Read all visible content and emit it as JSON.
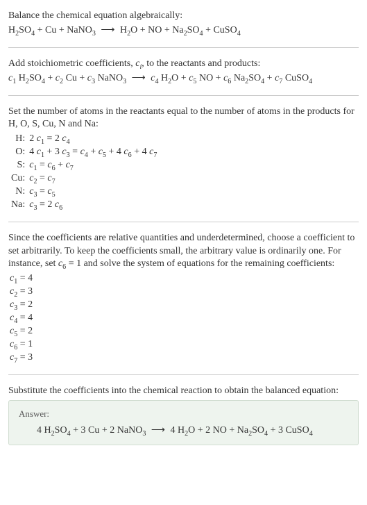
{
  "s1": {
    "intro": "Balance the chemical equation algebraically:",
    "eqn": "H<sub>2</sub>SO<sub>4</sub> + Cu + NaNO<sub>3</sub> <span class=\"arrow\">⟶</span> H<sub>2</sub>O + NO + Na<sub>2</sub>SO<sub>4</sub> + CuSO<sub>4</sub>"
  },
  "s2": {
    "intro": "Add stoichiometric coefficients, <span class=\"ci\">c<sub>i</sub></span>, to the reactants and products:",
    "eqn": "<span class=\"ci\">c</span><sub>1</sub> H<sub>2</sub>SO<sub>4</sub> + <span class=\"ci\">c</span><sub>2</sub> Cu + <span class=\"ci\">c</span><sub>3</sub> NaNO<sub>3</sub> <span class=\"arrow\">⟶</span> <span class=\"ci\">c</span><sub>4</sub> H<sub>2</sub>O + <span class=\"ci\">c</span><sub>5</sub> NO + <span class=\"ci\">c</span><sub>6</sub> Na<sub>2</sub>SO<sub>4</sub> + <span class=\"ci\">c</span><sub>7</sub> CuSO<sub>4</sub>"
  },
  "s3": {
    "intro": "Set the number of atoms in the reactants equal to the number of atoms in the products for H, O, S, Cu, N and Na:",
    "rows": [
      {
        "sym": "H:",
        "eq": "2 <span class=\"ci\">c</span><sub>1</sub> = 2 <span class=\"ci\">c</span><sub>4</sub>"
      },
      {
        "sym": "O:",
        "eq": "4 <span class=\"ci\">c</span><sub>1</sub> + 3 <span class=\"ci\">c</span><sub>3</sub> = <span class=\"ci\">c</span><sub>4</sub> + <span class=\"ci\">c</span><sub>5</sub> + 4 <span class=\"ci\">c</span><sub>6</sub> + 4 <span class=\"ci\">c</span><sub>7</sub>"
      },
      {
        "sym": "S:",
        "eq": "<span class=\"ci\">c</span><sub>1</sub> = <span class=\"ci\">c</span><sub>6</sub> + <span class=\"ci\">c</span><sub>7</sub>"
      },
      {
        "sym": "Cu:",
        "eq": "<span class=\"ci\">c</span><sub>2</sub> = <span class=\"ci\">c</span><sub>7</sub>"
      },
      {
        "sym": "N:",
        "eq": "<span class=\"ci\">c</span><sub>3</sub> = <span class=\"ci\">c</span><sub>5</sub>"
      },
      {
        "sym": "Na:",
        "eq": "<span class=\"ci\">c</span><sub>3</sub> = 2 <span class=\"ci\">c</span><sub>6</sub>"
      }
    ]
  },
  "s4": {
    "intro": "Since the coefficients are relative quantities and underdetermined, choose a coefficient to set arbitrarily. To keep the coefficients small, the arbitrary value is ordinarily one. For instance, set <span class=\"ci\">c</span><sub>6</sub> = 1 and solve the system of equations for the remaining coefficients:",
    "coeffs": [
      "<span class=\"ci\">c</span><sub>1</sub> = 4",
      "<span class=\"ci\">c</span><sub>2</sub> = 3",
      "<span class=\"ci\">c</span><sub>3</sub> = 2",
      "<span class=\"ci\">c</span><sub>4</sub> = 4",
      "<span class=\"ci\">c</span><sub>5</sub> = 2",
      "<span class=\"ci\">c</span><sub>6</sub> = 1",
      "<span class=\"ci\">c</span><sub>7</sub> = 3"
    ]
  },
  "s5": {
    "intro": "Substitute the coefficients into the chemical reaction to obtain the balanced equation:",
    "answer_label": "Answer:",
    "answer_eqn": "4 H<sub>2</sub>SO<sub>4</sub> + 3 Cu + 2 NaNO<sub>3</sub> <span class=\"arrow\">⟶</span> 4 H<sub>2</sub>O + 2 NO + Na<sub>2</sub>SO<sub>4</sub> + 3 CuSO<sub>4</sub>"
  }
}
